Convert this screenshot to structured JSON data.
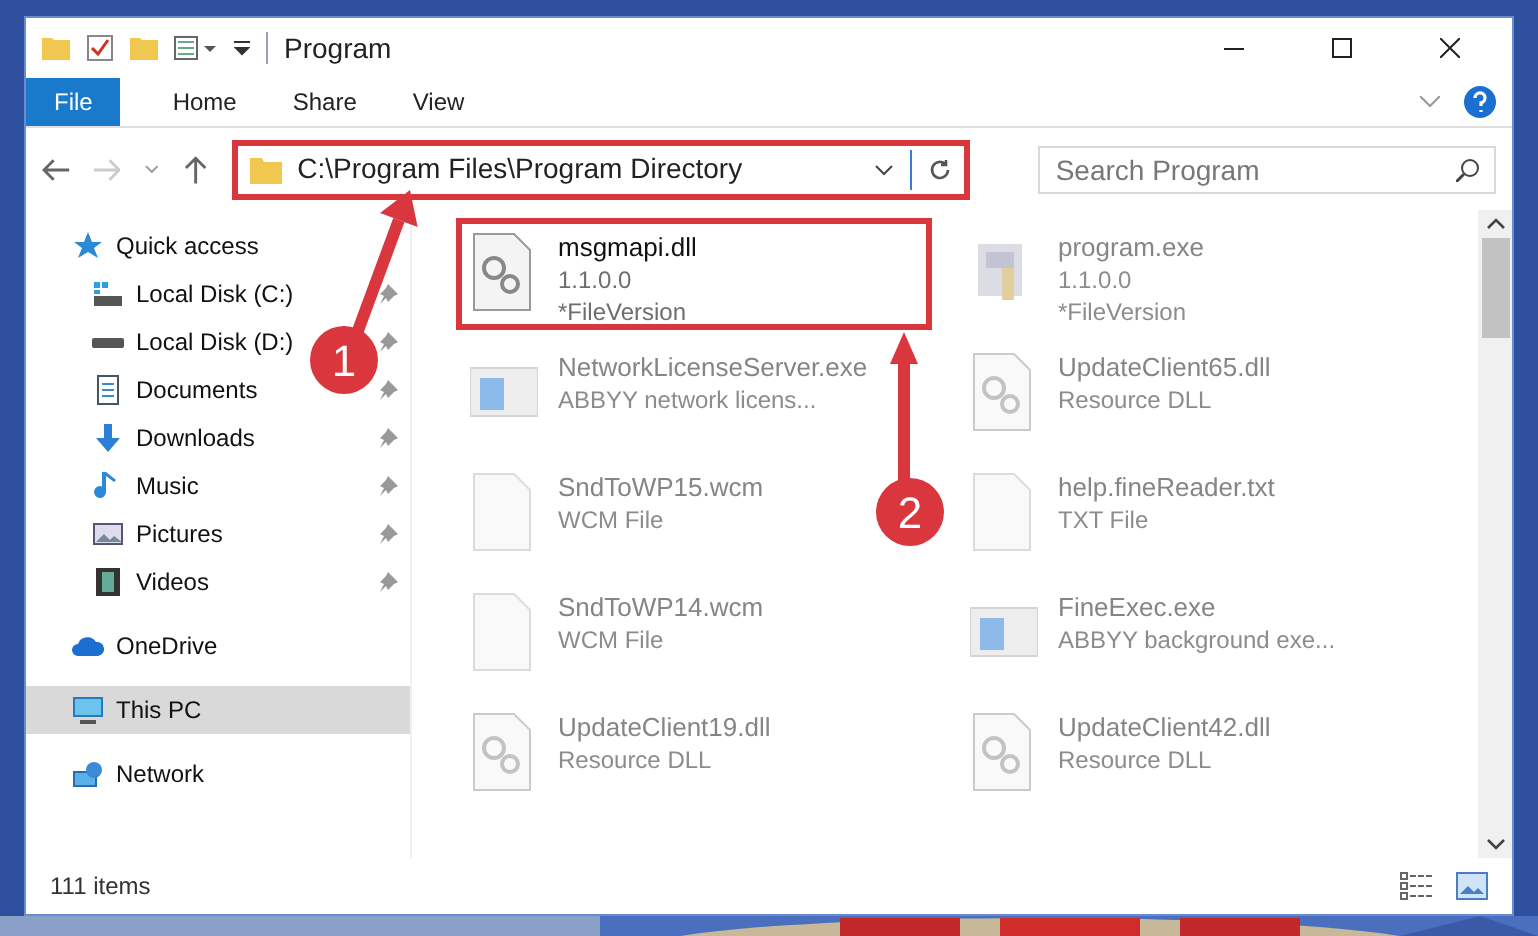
{
  "window": {
    "title": "Program"
  },
  "ribbon_tabs": [
    {
      "label": "File",
      "selected": true
    },
    {
      "label": "Home",
      "selected": false
    },
    {
      "label": "Share",
      "selected": false
    },
    {
      "label": "View",
      "selected": false
    }
  ],
  "address_bar": {
    "path": "C:\\Program Files\\Program Directory",
    "highlighted": true
  },
  "search": {
    "placeholder": "Search Program"
  },
  "sidebar": {
    "items": [
      {
        "label": "Quick access",
        "kind": "star",
        "pinned": false,
        "selected": false,
        "children": [
          {
            "label": "Local Disk (C:)",
            "kind": "drive-c",
            "pinned": true,
            "selected": false
          },
          {
            "label": "Local Disk (D:)",
            "kind": "drive",
            "pinned": true,
            "selected": false
          },
          {
            "label": "Documents",
            "kind": "documents",
            "pinned": true,
            "selected": false
          },
          {
            "label": "Downloads",
            "kind": "downloads",
            "pinned": true,
            "selected": false
          },
          {
            "label": "Music",
            "kind": "music",
            "pinned": true,
            "selected": false
          },
          {
            "label": "Pictures",
            "kind": "pictures",
            "pinned": true,
            "selected": false
          },
          {
            "label": "Videos",
            "kind": "videos",
            "pinned": true,
            "selected": false
          }
        ]
      },
      {
        "label": "OneDrive",
        "kind": "cloud",
        "pinned": false,
        "selected": false
      },
      {
        "label": "This PC",
        "kind": "pc",
        "pinned": false,
        "selected": true
      },
      {
        "label": "Network",
        "kind": "network",
        "pinned": false,
        "selected": false
      }
    ]
  },
  "files": [
    {
      "name": "msgmapi.dll",
      "details": [
        "1.1.0.0",
        "*FileVersion"
      ],
      "kind": "dll",
      "faded": false,
      "highlighted": true
    },
    {
      "name": "program.exe",
      "details": [
        "1.1.0.0",
        "*FileVersion"
      ],
      "kind": "app",
      "faded": true,
      "highlighted": false
    },
    {
      "name": "NetworkLicenseServer.exe",
      "details": [
        "ABBYY network licens..."
      ],
      "kind": "window",
      "faded": true,
      "highlighted": false
    },
    {
      "name": "UpdateClient65.dll",
      "details": [
        "Resource DLL"
      ],
      "kind": "dll",
      "faded": true,
      "highlighted": false
    },
    {
      "name": "SndToWP15.wcm",
      "details": [
        "WCM File"
      ],
      "kind": "blank",
      "faded": true,
      "highlighted": false
    },
    {
      "name": "help.fineReader.txt",
      "details": [
        "TXT File"
      ],
      "kind": "blank",
      "faded": true,
      "highlighted": false
    },
    {
      "name": "SndToWP14.wcm",
      "details": [
        "WCM File"
      ],
      "kind": "blank",
      "faded": true,
      "highlighted": false
    },
    {
      "name": "FineExec.exe",
      "details": [
        "ABBYY background exe..."
      ],
      "kind": "window",
      "faded": true,
      "highlighted": false
    },
    {
      "name": "UpdateClient19.dll",
      "details": [
        "Resource DLL"
      ],
      "kind": "dll",
      "faded": true,
      "highlighted": false
    },
    {
      "name": "UpdateClient42.dll",
      "details": [
        "Resource DLL"
      ],
      "kind": "dll",
      "faded": true,
      "highlighted": false
    }
  ],
  "status_bar": {
    "item_count": "111 items"
  },
  "annotations": [
    {
      "label": "1"
    },
    {
      "label": "2"
    }
  ]
}
